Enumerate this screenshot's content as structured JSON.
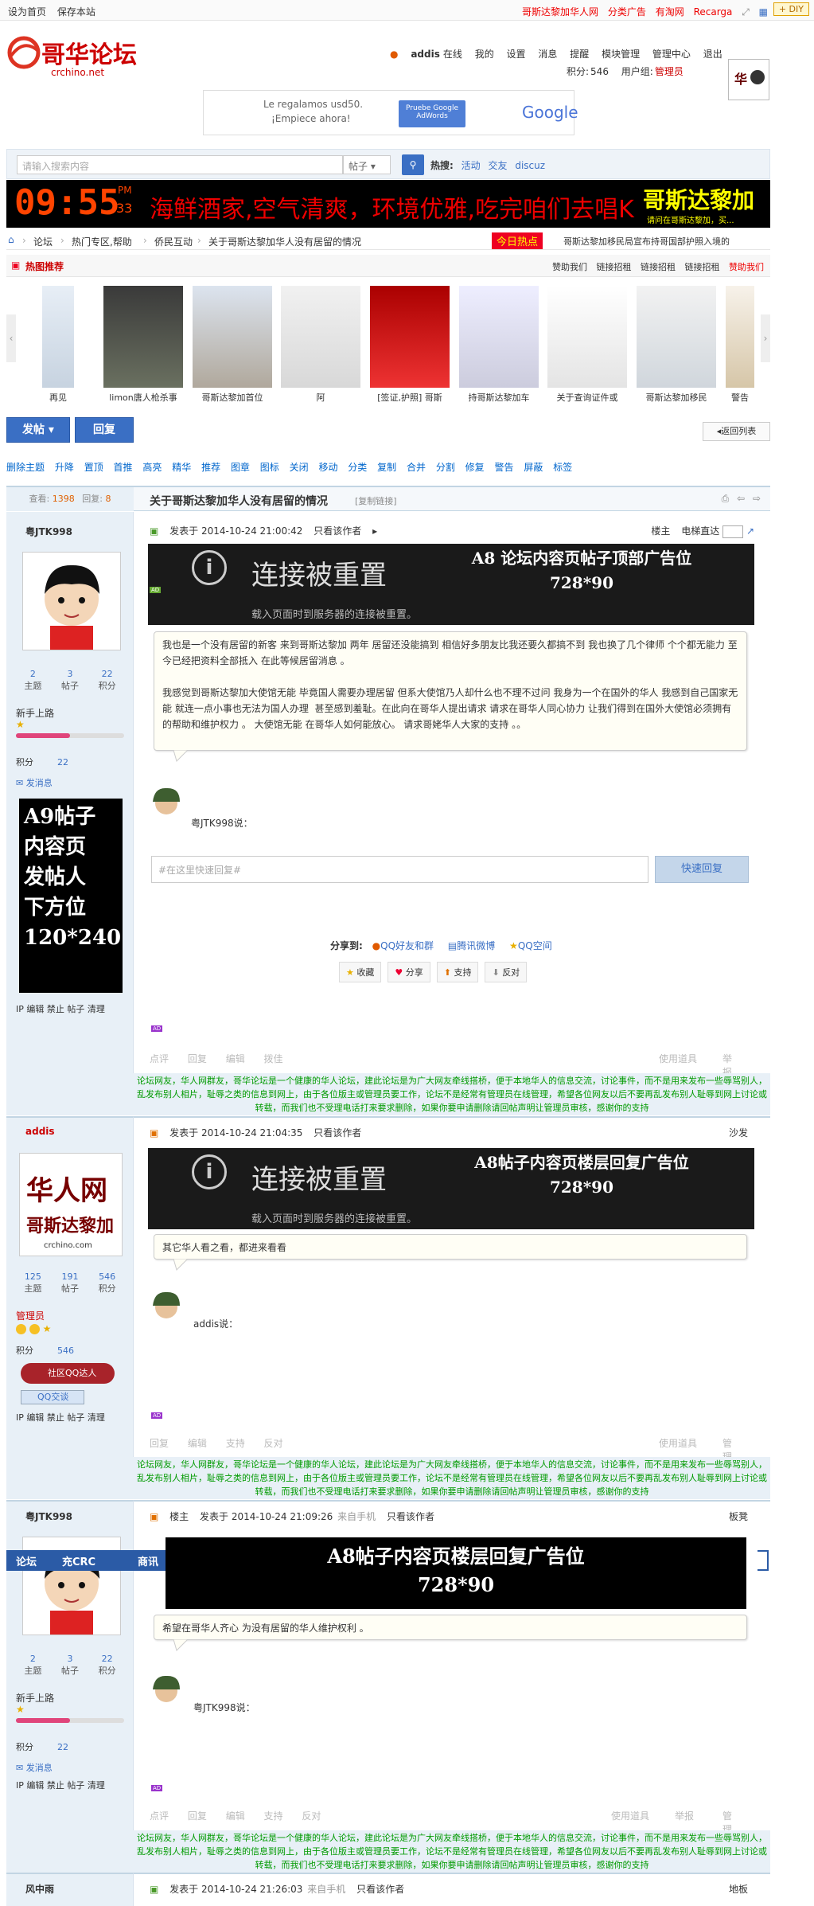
{
  "toplinks": {
    "set_home": "设为首页",
    "save_desktop": "保存本站",
    "right": [
      "哥斯达黎加华人网",
      "分类广告",
      "有淘网",
      "Recarga"
    ],
    "diy": "+ DIY"
  },
  "logo": {
    "cn": "哥华论坛",
    "url": "crchino.net"
  },
  "user": {
    "name": "addis",
    "status": "在线",
    "menu": [
      "我的",
      "设置",
      "消息",
      "提醒",
      "模块管理",
      "管理中心",
      "退出"
    ],
    "points_label": "积分:",
    "points": "546",
    "group_label": "用户组:",
    "group": "管理员"
  },
  "ad_top": {
    "line1": "Le regalamos usd50.",
    "line2": "¡Empiece ahora!",
    "btn": "Pruebe Google AdWords",
    "brand": "Google"
  },
  "search": {
    "placeholder": "请输入搜索内容",
    "type": "帖子",
    "hot_label": "热搜:",
    "hot": [
      "活动",
      "交友",
      "discuz"
    ]
  },
  "marquee": {
    "time": "09:55",
    "pm": "PM",
    "sec": "33",
    "text": "海鲜酒家,空气清爽，环境优雅,吃完咱们去唱K",
    "brand": "哥斯达黎加",
    "brand_sub": "请问在哥斯达黎加，买..."
  },
  "crumb": {
    "items": [
      "论坛",
      "热门专区,帮助",
      "侨民互动",
      "关于哥斯达黎加华人没有居留的情况"
    ],
    "hot_today": "今日热点",
    "hot_text": "哥斯达黎加移民局宣布持哥国部护照入境的"
  },
  "hotbar": {
    "title": "热图推荐",
    "links": [
      "赞助我们",
      "链接招租",
      "链接招租",
      "链接招租",
      "赞助我们"
    ]
  },
  "gallery": [
    "再见",
    "limon唐人枪杀事",
    "哥斯达黎加首位",
    "阿",
    "[签证,护照] 哥斯",
    "持哥斯达黎加车",
    "关于查询证件或",
    "哥斯达黎加移民",
    "警告"
  ],
  "buttons": {
    "post": "发帖",
    "reply": "回复",
    "back": "返回列表"
  },
  "modbar": [
    "删除主题",
    "升降",
    "置顶",
    "首推",
    "高亮",
    "精华",
    "推荐",
    "图章",
    "图标",
    "关闭",
    "移动",
    "分类",
    "复制",
    "合并",
    "分割",
    "修复",
    "警告",
    "屏蔽",
    "标签"
  ],
  "thread": {
    "views_label": "查看:",
    "views": "1398",
    "replies_label": "回复:",
    "replies": "8",
    "title": "关于哥斯达黎加华人没有居留的情况",
    "copy": "[复制链接]",
    "quick_reply": "#在这里快速回复#",
    "quick_btn": "快速回复",
    "share_label": "分享到:",
    "share": [
      "QQ好友和群",
      "腾讯微博",
      "QQ空间"
    ],
    "actions": [
      "收藏",
      "分享",
      "支持",
      "反对"
    ]
  },
  "post1": {
    "author": "粤JTK998",
    "time": "发表于 2014-10-24 21:00:42",
    "only": "只看该作者",
    "floor": "楼主",
    "elevator": "电梯直达",
    "stats": [
      {
        "n": "2",
        "k": "主题"
      },
      {
        "n": "3",
        "k": "帖子"
      },
      {
        "n": "22",
        "k": "积分"
      }
    ],
    "rank": "新手上路",
    "points_label": "积分",
    "points": "22",
    "msg": "发消息",
    "ad": "A9帖子内容页发帖人下方位120*240",
    "ad_lines": [
      "A9帖子",
      "内容页",
      "发帖人",
      "下方位",
      "120*240"
    ],
    "ctrl": "IP 编辑 禁止 帖子 清理",
    "conn_title": "连接被重置",
    "conn_sub": "载入页面时到服务器的连接被重置。",
    "ad_top_l1": "A8 论坛内容页帖子顶部广告位",
    "ad_top_l2": "728*90",
    "body": "我也是一个没有居留的新客 来到哥斯达黎加 两年 居留还没能搞到 相信好多朋友比我还要久都搞不到 我也换了几个律师 个个都无能力 至今已经把资料全部抵入 在此等候居留消息 。\n\n我感觉到哥斯达黎加大使馆无能 毕竟国人需要办理居留 但系大使馆乃人却什么也不理不过问 我身为一个在国外的华人 我感到自己国家无能 就连一点小事也无法为国人办理  甚至感到羞耻。在此向在哥华人提出请求 请求在哥华人同心协力 让我们得到在国外大使馆必须拥有的帮助和维护权力 。 大使馆无能 在哥华人如何能放心。 请求哥姥华人大家的支持 。。",
    "said": "粤JTK998说：",
    "bottom": [
      "点评",
      "回复",
      "编辑",
      "拨佳",
      "使用道具",
      "举报"
    ]
  },
  "notice": "论坛网友，华人网群友，哥华论坛是一个健康的华人论坛，建此论坛是为广大网友牵线搭桥，便于本地华人的信息交流，讨论事件，而不是用来发布一些辱骂别人，乱发布别人相片，耻辱之类的信息到网上，由于各位版主或管理员要工作，论坛不是经常有管理员在线管理，希望各位网友以后不要再乱发布别人耻辱到网上讨论或转载，而我们也不受理电话打来要求删除，如果你要申请删除请回帖声明让管理员审核，感谢你的支持",
  "post2": {
    "author": "addis",
    "time": "发表于 2014-10-24 21:04:35",
    "only": "只看该作者",
    "floor": "沙发",
    "stats": [
      {
        "n": "125",
        "k": "主题"
      },
      {
        "n": "191",
        "k": "帖子"
      },
      {
        "n": "546",
        "k": "积分"
      }
    ],
    "rank": "管理员",
    "points_label": "积分",
    "points": "546",
    "badge1": "社区QQ达人",
    "badge2": "QQ交谈",
    "ctrl": "IP 编辑 禁止 帖子 清理",
    "ad_l1": "A8帖子内容页楼层回复广告位",
    "ad_l2": "728*90",
    "body": "其它华人看之看，都进来看看",
    "said": "addis说：",
    "bottom": [
      "回复",
      "编辑",
      "支持",
      "反对",
      "使用道具",
      "管理"
    ],
    "avatar_text": "华人网 哥斯达黎加 crchino.com"
  },
  "post3": {
    "author": "粤JTK998",
    "floor_label": "楼主",
    "time": "发表于 2014-10-24 21:09:26",
    "from": "来自手机",
    "only": "只看该作者",
    "floor": "板凳",
    "stats": [
      {
        "n": "2",
        "k": "主题"
      },
      {
        "n": "3",
        "k": "帖子"
      },
      {
        "n": "22",
        "k": "积分"
      }
    ],
    "rank": "新手上路",
    "points_label": "积分",
    "points": "22",
    "msg": "发消息",
    "ctrl": "IP 编辑 禁止 帖子 清理",
    "ad_l1": "A8帖子内容页楼层回复广告位",
    "ad_l2": "728*90",
    "body": "希望在哥华人齐心 为没有居留的华人维护权利 。",
    "said": "粤JTK998说：",
    "bottom": [
      "点评",
      "回复",
      "编辑",
      "支持",
      "反对",
      "使用道具",
      "举报",
      "管理"
    ]
  },
  "floatnav": [
    "论坛",
    "充CRC",
    "商讯"
  ],
  "post4": {
    "author": "风中雨",
    "time": "发表于 2014-10-24 21:26:03",
    "from": "来自手机",
    "only": "只看该作者",
    "floor": "地板"
  }
}
